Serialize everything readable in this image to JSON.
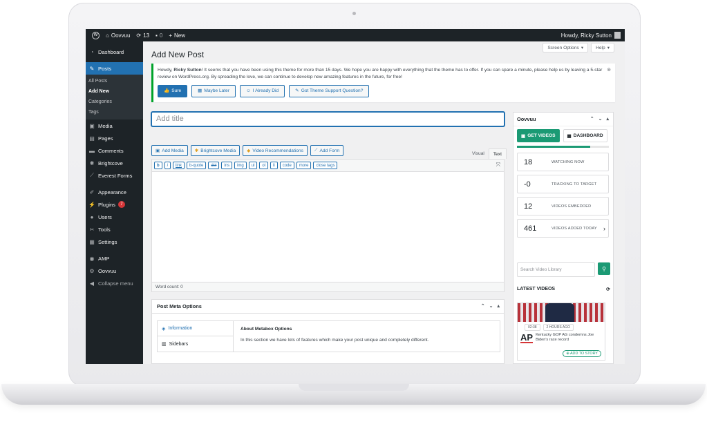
{
  "adminbar": {
    "site_name": "Oovvuu",
    "updates_count": "13",
    "comments_count": "0",
    "new_label": "New",
    "howdy": "Howdy, Ricky Sutton"
  },
  "sidebar": {
    "items": [
      {
        "label": "Dashboard",
        "icon": "dashboard-icon"
      },
      {
        "label": "Posts",
        "icon": "pin-icon"
      },
      {
        "label": "Media",
        "icon": "media-icon"
      },
      {
        "label": "Pages",
        "icon": "pages-icon"
      },
      {
        "label": "Comments",
        "icon": "comment-icon"
      },
      {
        "label": "Brightcove",
        "icon": "brightcove-icon"
      },
      {
        "label": "Everest Forms",
        "icon": "form-icon"
      },
      {
        "label": "Appearance",
        "icon": "brush-icon"
      },
      {
        "label": "Plugins",
        "icon": "plugin-icon",
        "badge": "7"
      },
      {
        "label": "Users",
        "icon": "user-icon"
      },
      {
        "label": "Tools",
        "icon": "wrench-icon"
      },
      {
        "label": "Settings",
        "icon": "settings-icon"
      },
      {
        "label": "AMP",
        "icon": "amp-icon"
      },
      {
        "label": "Oovvuu",
        "icon": "gear-icon"
      },
      {
        "label": "Collapse menu",
        "icon": "collapse-icon"
      }
    ],
    "posts_submenu": [
      "All Posts",
      "Add New",
      "Categories",
      "Tags"
    ]
  },
  "header": {
    "title": "Add New Post",
    "screen_options": "Screen Options",
    "help": "Help"
  },
  "notice": {
    "text_before": "Howdy, ",
    "name": "Ricky Sutton",
    "text_after": "! It seems that you have been using this theme for more than 15 days. We hope you are happy with everything that the theme has to offer. If you can spare a minute, please help us by leaving a 5-star review on WordPress.org. By spreading the love, we can continue to develop new amazing features in the future, for free!",
    "buttons": [
      "Sure",
      "Maybe Later",
      "I Already Did",
      "Got Theme Support Question?"
    ]
  },
  "editor": {
    "title_placeholder": "Add title",
    "media_buttons": [
      "Add Media",
      "Brightcove Media",
      "Video Recommendations",
      "Add Form"
    ],
    "tabs": [
      "Visual",
      "Text"
    ],
    "quicktags": [
      "b",
      "i",
      "link",
      "b-quote",
      "del",
      "ins",
      "img",
      "ul",
      "ol",
      "li",
      "code",
      "more",
      "close tags"
    ],
    "word_count": "Word count: 0"
  },
  "metabox": {
    "title": "Post Meta Options",
    "tabs": [
      "Information",
      "Sidebars"
    ],
    "heading": "About Metabox Options",
    "body": "In this section we have lots of features which make your post unique and completely different."
  },
  "widget": {
    "title": "Oovvuu",
    "get_videos": "GET VIDEOS",
    "dashboard": "DASHBOARD",
    "progress": 0.8,
    "stats": [
      {
        "value": "18",
        "label": "WATCHING NOW"
      },
      {
        "value": "-0",
        "label": "TRACKING TO TARGET"
      },
      {
        "value": "12",
        "label": "VIDEOS EMBEDDED"
      },
      {
        "value": "461",
        "label": "VIDEOS ADDED TODAY"
      }
    ],
    "search_placeholder": "Search Video Library",
    "latest_videos": "LATEST VIDEOS",
    "video": {
      "duration": "02:38",
      "age": "2 HOURS AGO",
      "source": "AP",
      "title": "Kentucky GOP AG condemns Joe Biden's race record",
      "add_label": "ADD TO STORY"
    }
  },
  "colors": {
    "accent": "#2271b1",
    "oovvuu_green": "#1b9a74",
    "admin_dark": "#1d2327"
  }
}
